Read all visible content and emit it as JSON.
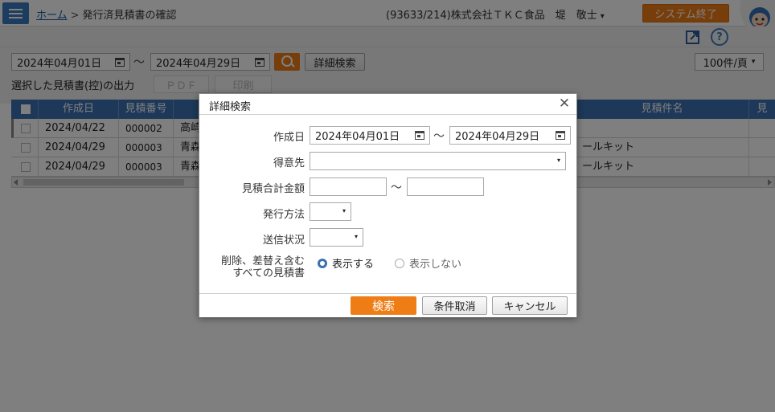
{
  "header": {
    "breadcrumb_home": "ホーム",
    "breadcrumb_sep": ">",
    "breadcrumb_current": "発行済見積書の確認",
    "user": "(93633/214)株式会社ＴＫＣ食品　堤　敬士",
    "user_caret": "▾",
    "exit_label": "システム終了",
    "help_glyph": "?"
  },
  "search": {
    "date_from": "2024年04月01日",
    "date_to": "2024年04月29日",
    "range_sep": "〜",
    "detail_label": "詳細検索",
    "per_page": "100件/頁",
    "per_page_caret": "▾",
    "output_label": "選択した見積書(控)の出力",
    "pdf_label": "ＰＤＦ",
    "print_label": "印刷"
  },
  "table": {
    "columns": [
      "作成日",
      "見積番号",
      "",
      "見積件名"
    ],
    "rows": [
      {
        "date": "2024/04/22",
        "number": "000002",
        "client": "高崎",
        "title": ""
      },
      {
        "date": "2024/04/29",
        "number": "000003",
        "client": "青森",
        "title": "ールキット"
      },
      {
        "date": "2024/04/29",
        "number": "000003",
        "client": "青森",
        "title": "ールキット"
      }
    ],
    "last_col_fragment": "見"
  },
  "dialog": {
    "title": "詳細検索",
    "close_glyph": "✕",
    "created_label": "作成日",
    "date_from": "2024年04月01日",
    "date_to": "2024年04月29日",
    "range_sep": "〜",
    "client_label": "得意先",
    "client_value": "",
    "amount_label": "見積合計金額",
    "amount_from": "",
    "amount_to": "",
    "method_label": "発行方法",
    "status_label": "送信状況",
    "include_label_1": "削除、差替え含む",
    "include_label_2": "すべての見積書",
    "radio_show": "表示する",
    "radio_hide": "表示しない",
    "select_caret": "▾",
    "btn_search": "検索",
    "btn_clear": "条件取消",
    "btn_cancel": "キャンセル"
  },
  "colors": {
    "accent_blue": "#3a70b0",
    "accent_orange": "#ef7d16"
  }
}
